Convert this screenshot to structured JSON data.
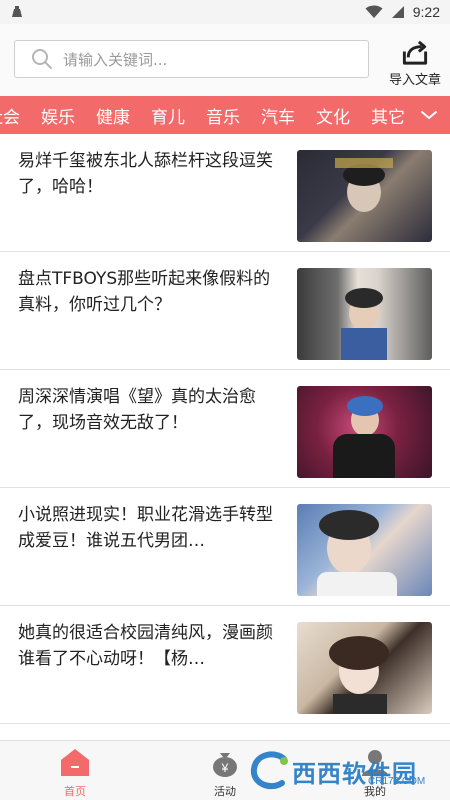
{
  "status_bar": {
    "time": "9:22"
  },
  "search": {
    "placeholder": "请输入关键词..."
  },
  "header": {
    "import_label": "导入文章"
  },
  "categories": {
    "items": [
      "社会",
      "娱乐",
      "健康",
      "育儿",
      "音乐",
      "汽车",
      "文化",
      "其它"
    ]
  },
  "articles": [
    {
      "title": "易烊千玺被东北人舔栏杆这段逗笑了，哈哈！"
    },
    {
      "title": "盘点TFBOYS那些听起来像假料的真料，你听过几个？"
    },
    {
      "title": "周深深情演唱《望》真的太治愈了，现场音效无敌了！"
    },
    {
      "title": "小说照进现实！职业花滑选手转型成爱豆！谁说五代男团…"
    },
    {
      "title": "她真的很适合校园清纯风，漫画颜谁看了不心动呀！【杨…"
    }
  ],
  "bottom_nav": {
    "home": "首页",
    "activity": "活动",
    "mine": "我的"
  },
  "watermark": {
    "text": "西西软件园",
    "sub": "CR173.COM"
  },
  "colors": {
    "accent": "#f36a6a"
  }
}
